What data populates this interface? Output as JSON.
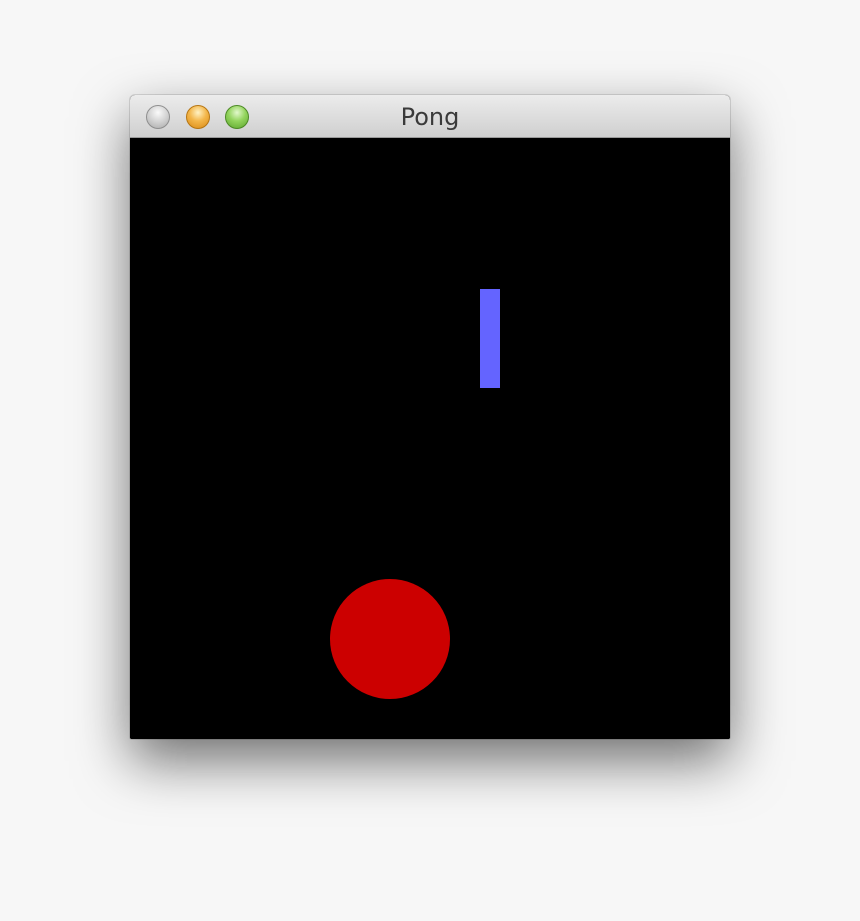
{
  "window": {
    "title": "Pong"
  },
  "titlebar": {
    "buttons": [
      {
        "name": "close-button",
        "icon": "close-icon",
        "color": "#c8c8c8"
      },
      {
        "name": "minimize-button",
        "icon": "minimize-icon",
        "color": "#f0a93a"
      },
      {
        "name": "zoom-button",
        "icon": "zoom-icon",
        "color": "#7cc44b"
      }
    ]
  },
  "game": {
    "background_color": "#000000",
    "paddle_color": "#6464ff",
    "ball_color": "#cc0000"
  }
}
